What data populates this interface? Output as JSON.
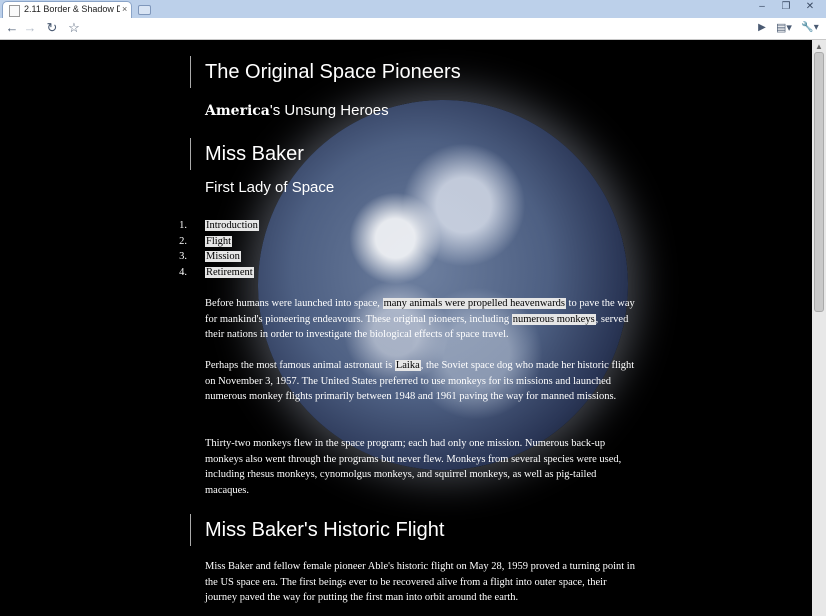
{
  "browser": {
    "tab_title": "2.11 Border & Shadow De...",
    "tab_close": "×",
    "min": "–",
    "max": "❐",
    "close": "✕",
    "back": "←",
    "forward": "→",
    "reload": "↻",
    "star": "☆",
    "play": "▶",
    "page_menu": "▤▾",
    "wrench": "🔧▾"
  },
  "page": {
    "title": "The Original Space Pioneers",
    "subtitle_bold": "America",
    "subtitle_rest": "'s Unsung Heroes",
    "section_title": "Miss Baker",
    "section_subtitle": "First Lady of Space",
    "toc": [
      {
        "num": "1.",
        "label": "Introduction"
      },
      {
        "num": "2.",
        "label": "Flight"
      },
      {
        "num": "3.",
        "label": "Mission"
      },
      {
        "num": "4.",
        "label": "Retirement"
      }
    ],
    "p1": {
      "a": "Before humans were launched into space, ",
      "hl1": "many animals were propelled heavenwards",
      "b": " to pave the way for mankind's pioneering endeavours. These original pioneers, including ",
      "hl2": "numerous monkeys",
      "c": ", served their nations in order to investigate the biological effects of space travel."
    },
    "p2": {
      "a": "Perhaps the most famous animal astronaut is ",
      "hl": "Laika",
      "b": ", the Soviet space dog who made her historic flight on November 3, 1957. The United States preferred to use monkeys for its missions and launched numerous monkey flights primarily between 1948 and 1961 paving the way for manned missions."
    },
    "p3": "Thirty-two monkeys flew in the space program; each had only one mission. Numerous back-up monkeys also went through the programs but never flew. Monkeys from several species were used, including rhesus monkeys, cynomolgus monkeys, and squirrel monkeys, as well as pig-tailed macaques.",
    "flight_title": "Miss Baker's Historic Flight",
    "p4": "Miss Baker and fellow female pioneer Able's historic flight on May 28, 1959 proved a turning point in the US space era. The first beings ever to be recovered alive from a flight into outer space, their journey paved the way for putting the first man into orbit around the earth."
  }
}
